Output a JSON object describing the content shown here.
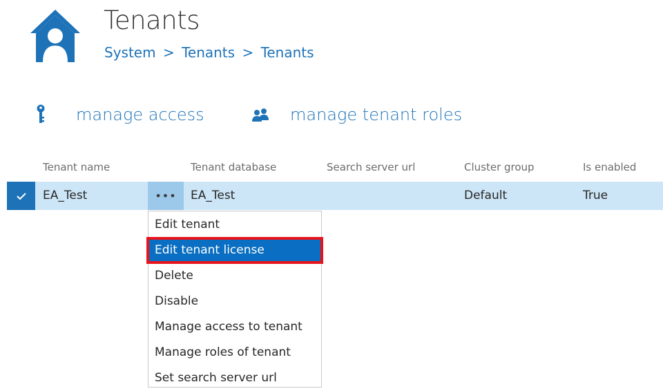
{
  "header": {
    "title": "Tenants",
    "breadcrumb": [
      "System",
      "Tenants",
      "Tenants"
    ],
    "breadcrumb_separator": ">",
    "icon": "house-user-icon"
  },
  "toolbar": {
    "manage_access": {
      "label": "manage access",
      "icon": "key-icon"
    },
    "manage_tenant_roles": {
      "label": "manage tenant roles",
      "icon": "users-icon"
    }
  },
  "table": {
    "columns": [
      "Tenant name",
      "Tenant database",
      "Search server url",
      "Cluster group",
      "Is enabled"
    ],
    "rows": [
      {
        "selected": true,
        "tenant_name": "EA_Test",
        "tenant_database": "EA_Test",
        "search_server_url": "",
        "cluster_group": "Default",
        "is_enabled": "True",
        "actions_label": "•••"
      }
    ]
  },
  "context_menu": {
    "items": [
      "Edit tenant",
      "Edit tenant license",
      "Delete",
      "Disable",
      "Manage access to tenant",
      "Manage roles of tenant",
      "Set search server url"
    ],
    "highlighted_index": 1
  },
  "colors": {
    "accent": "#1e73b8",
    "row_selected": "#cde6f7",
    "menu_highlight": "#0a6fc2",
    "annotation_red": "#e8141c"
  }
}
